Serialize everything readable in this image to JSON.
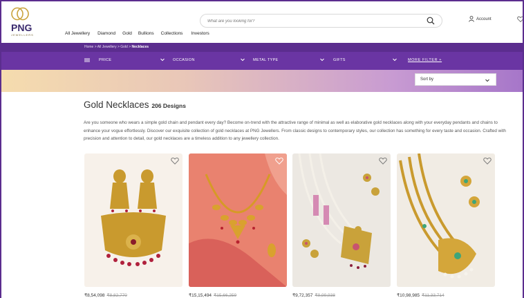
{
  "brand": {
    "name": "PNG",
    "sub": "JEWELLERS",
    "colors": {
      "primary": "#5b2d8e",
      "filter": "#6a35a3",
      "gold": "#c9a23a"
    }
  },
  "search": {
    "placeholder": "What are you looking for?"
  },
  "account_label": "Account",
  "nav": [
    {
      "label": "All Jewellery"
    },
    {
      "label": "Diamond"
    },
    {
      "label": "Gold"
    },
    {
      "label": "Bullions"
    },
    {
      "label": "Collections"
    },
    {
      "label": "Investors"
    }
  ],
  "breadcrumb": {
    "items": [
      "Home",
      "All Jewellery",
      "Gold"
    ],
    "separator": ">",
    "current": "Necklaces"
  },
  "filters": [
    {
      "label": "PRICE"
    },
    {
      "label": "OCCASION"
    },
    {
      "label": "METAL TYPE"
    },
    {
      "label": "GIFTS"
    }
  ],
  "more_filter": "MORE FILTER +",
  "sort": {
    "label": "Sort by"
  },
  "page": {
    "title": "Gold Necklaces",
    "count": "206 Designs",
    "description": "Are you someone who wears a simple gold chain and pendant every day? Become on-trend with the attractive range of minimal as well as elaborative gold necklaces along with your everyday pendants and chains to enhance your vogue effortlessly. Discover our exquisite collection of gold necklaces at PNG Jewellers. From classic designs to contemporary styles, our collection has something for every taste and occasion. Crafted with precision and attention to detail, our gold necklaces are a timeless addition to any jewellery collection."
  },
  "products": [
    {
      "price": "₹8,54,098",
      "mrp": "₹8,82,770",
      "bg": "#f7f1ea"
    },
    {
      "price": "₹15,15,494",
      "mrp": "₹15,66,259",
      "bg": "#e9826f"
    },
    {
      "price": "₹9,72,357",
      "mrp": "₹9,99,938",
      "bg": "#ece8e2"
    },
    {
      "price": "₹10,98,985",
      "mrp": "₹11,33,714",
      "bg": "#f1ece4"
    }
  ]
}
